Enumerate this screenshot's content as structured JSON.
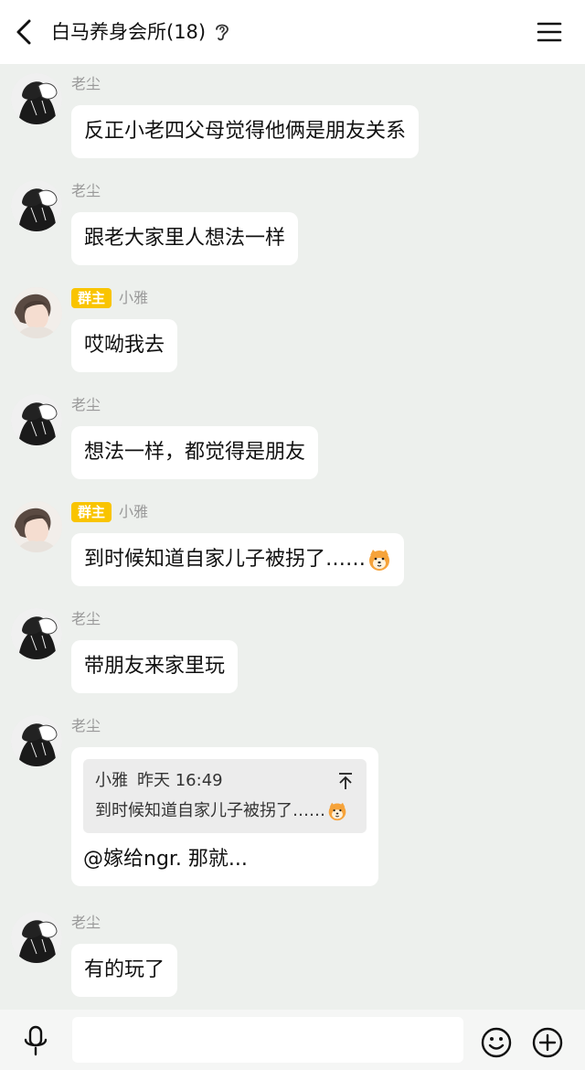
{
  "header": {
    "title": "白马养身会所(18)",
    "icons": {
      "back": "chevron-left-icon",
      "ear": "ear-icon",
      "menu": "hamburger-menu-icon"
    }
  },
  "messages": [
    {
      "sender": "老尘",
      "badge": "",
      "text": "反正小老四父母觉得他俩是朋友关系",
      "avatar": "laochen"
    },
    {
      "sender": "老尘",
      "badge": "",
      "text": "跟老大家里人想法一样",
      "avatar": "laochen"
    },
    {
      "sender": "小雅",
      "badge": "群主",
      "text": "哎呦我去",
      "avatar": "xiaoya"
    },
    {
      "sender": "老尘",
      "badge": "",
      "text": "想法一样，都觉得是朋友",
      "avatar": "laochen"
    },
    {
      "sender": "小雅",
      "badge": "群主",
      "text": "到时候知道自家儿子被拐了……",
      "avatar": "xiaoya",
      "emoji": "shiba-dog-emoji"
    },
    {
      "sender": "老尘",
      "badge": "",
      "text": "带朋友来家里玩",
      "avatar": "laochen"
    },
    {
      "sender": "老尘",
      "badge": "",
      "avatar": "laochen",
      "quote": {
        "author": "小雅",
        "time": "昨天 16:49",
        "text": "到时候知道自家儿子被拐了……",
        "emoji": "shiba-dog-emoji"
      },
      "text": "@嫁给ngr. 那就..."
    },
    {
      "sender": "老尘",
      "badge": "",
      "text": "有的玩了",
      "avatar": "laochen"
    }
  ],
  "input_bar": {
    "value": "",
    "icons": {
      "voice": "microphone-icon",
      "emoji": "smiley-icon",
      "more": "plus-circle-icon"
    }
  },
  "colors": {
    "background": "#edf0ed",
    "header": "#ffffff",
    "bubble": "#ffffff",
    "badge": "#f9c400",
    "sender": "#999999",
    "quote_box": "#ececec"
  }
}
